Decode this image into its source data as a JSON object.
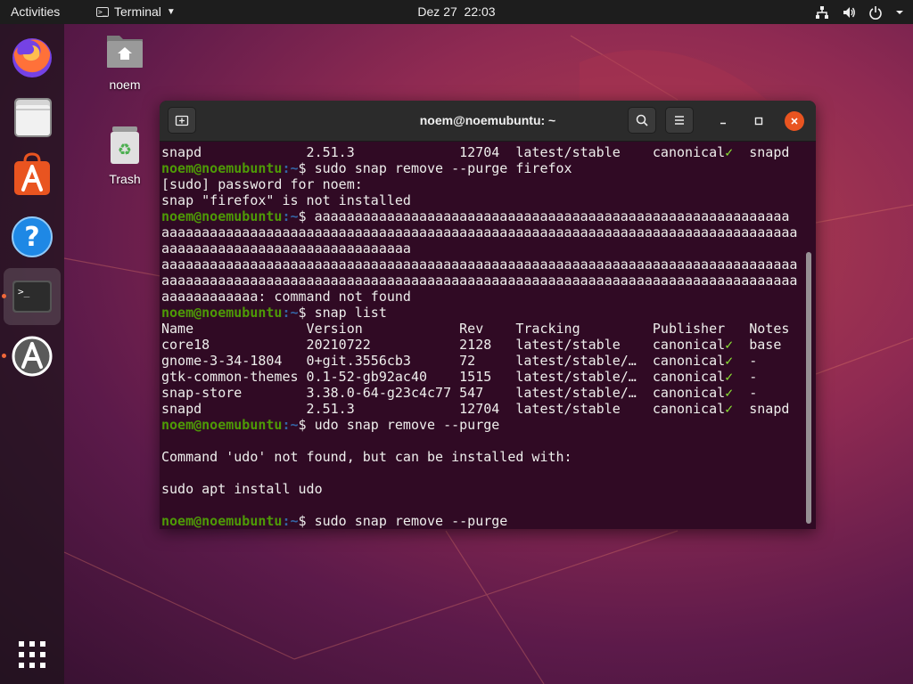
{
  "topbar": {
    "activities": "Activities",
    "app_name": "Terminal",
    "clock": "Dez 27  22:03",
    "icons": [
      "network-icon",
      "volume-icon",
      "power-icon",
      "menu-arrow-icon"
    ]
  },
  "dock": {
    "items": [
      "firefox",
      "files",
      "ubuntu-software",
      "help",
      "terminal",
      "software-updater"
    ],
    "apps_grid": "show-applications-icon"
  },
  "desktop": {
    "home_label": "noem",
    "trash_label": "Trash"
  },
  "colors": {
    "accent": "#e95420",
    "terminal_bg": "#300a24",
    "prompt_user": "#4e9a06",
    "prompt_path": "#3465a4"
  },
  "terminal": {
    "title": "noem@noemubuntu: ~",
    "lines": [
      {
        "type": "text",
        "text": "snapd             2.51.3             12704  latest/stable    canonical✓  snapd"
      },
      {
        "type": "prompt",
        "user": "noem@noemubuntu",
        "path": ":~",
        "cmd": "$ sudo snap remove --purge firefox"
      },
      {
        "type": "text",
        "text": "[sudo] password for noem:"
      },
      {
        "type": "text",
        "text": "snap \"firefox\" is not installed"
      },
      {
        "type": "prompt",
        "user": "noem@noemubuntu",
        "path": ":~",
        "cmd": "$ aaaaaaaaaaaaaaaaaaaaaaaaaaaaaaaaaaaaaaaaaaaaaaaaaaaaaaaaaaa"
      },
      {
        "type": "text",
        "text": "aaaaaaaaaaaaaaaaaaaaaaaaaaaaaaaaaaaaaaaaaaaaaaaaaaaaaaaaaaaaaaaaaaaaaaaaaaaaaaa"
      },
      {
        "type": "text",
        "text": "aaaaaaaaaaaaaaaaaaaaaaaaaaaaaaa"
      },
      {
        "type": "text",
        "text": "aaaaaaaaaaaaaaaaaaaaaaaaaaaaaaaaaaaaaaaaaaaaaaaaaaaaaaaaaaaaaaaaaaaaaaaaaaaaaaa"
      },
      {
        "type": "text",
        "text": "aaaaaaaaaaaaaaaaaaaaaaaaaaaaaaaaaaaaaaaaaaaaaaaaaaaaaaaaaaaaaaaaaaaaaaaaaaaaaaa"
      },
      {
        "type": "text",
        "text": "aaaaaaaaaaaa: command not found"
      },
      {
        "type": "prompt",
        "user": "noem@noemubuntu",
        "path": ":~",
        "cmd": "$ snap list"
      },
      {
        "type": "text",
        "text": "Name              Version            Rev    Tracking         Publisher   Notes"
      },
      {
        "type": "text",
        "text": "core18            20210722           2128   latest/stable    canonical✓  base"
      },
      {
        "type": "text",
        "text": "gnome-3-34-1804   0+git.3556cb3      72     latest/stable/…  canonical✓  -"
      },
      {
        "type": "text",
        "text": "gtk-common-themes 0.1-52-gb92ac40    1515   latest/stable/…  canonical✓  -"
      },
      {
        "type": "text",
        "text": "snap-store        3.38.0-64-g23c4c77 547    latest/stable/…  canonical✓  -"
      },
      {
        "type": "text",
        "text": "snapd             2.51.3             12704  latest/stable    canonical✓  snapd"
      },
      {
        "type": "prompt",
        "user": "noem@noemubuntu",
        "path": ":~",
        "cmd": "$ udo snap remove --purge"
      },
      {
        "type": "text",
        "text": ""
      },
      {
        "type": "text",
        "text": "Command 'udo' not found, but can be installed with:"
      },
      {
        "type": "text",
        "text": ""
      },
      {
        "type": "text",
        "text": "sudo apt install udo"
      },
      {
        "type": "text",
        "text": ""
      },
      {
        "type": "prompt",
        "user": "noem@noemubuntu",
        "path": ":~",
        "cmd": "$ sudo snap remove --purge"
      }
    ]
  }
}
